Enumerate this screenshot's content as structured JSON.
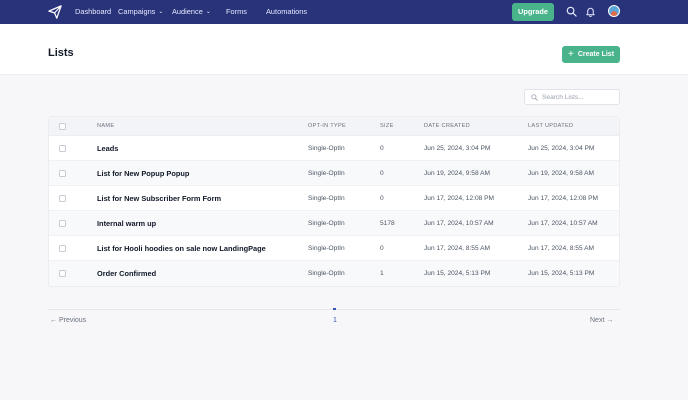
{
  "nav": {
    "items": [
      {
        "label": "Dashboard",
        "dropdown": false
      },
      {
        "label": "Campaigns",
        "dropdown": true
      },
      {
        "label": "Audience",
        "dropdown": true
      },
      {
        "label": "Forms",
        "dropdown": false
      },
      {
        "label": "Automations",
        "dropdown": false
      }
    ],
    "upgrade_label": "Upgrade",
    "icons": [
      "paper-plane-logo",
      "search-icon",
      "bell-icon",
      "avatar"
    ]
  },
  "header": {
    "title": "Lists",
    "create_label": "Create List"
  },
  "search": {
    "placeholder": "Search Lists..."
  },
  "table": {
    "columns": [
      "NAME",
      "OPT-IN TYPE",
      "SIZE",
      "DATE CREATED",
      "LAST UPDATED"
    ],
    "rows": [
      {
        "name": "Leads",
        "optin": "Single-OptIn",
        "size": "0",
        "created": "Jun 25, 2024, 3:04 PM",
        "updated": "Jun 25, 2024, 3:04 PM"
      },
      {
        "name": "List for New Popup Popup",
        "optin": "Single-OptIn",
        "size": "0",
        "created": "Jun 19, 2024, 9:58 AM",
        "updated": "Jun 19, 2024, 9:58 AM"
      },
      {
        "name": "List for New Subscriber Form Form",
        "optin": "Single-OptIn",
        "size": "0",
        "created": "Jun 17, 2024, 12:08 PM",
        "updated": "Jun 17, 2024, 12:08 PM"
      },
      {
        "name": "Internal warm up",
        "optin": "Single-OptIn",
        "size": "5178",
        "created": "Jun 17, 2024, 10:57 AM",
        "updated": "Jun 17, 2024, 10:57 AM"
      },
      {
        "name": "List for Hooli hoodies on sale now LandingPage",
        "optin": "Single-OptIn",
        "size": "0",
        "created": "Jun 17, 2024, 8:55 AM",
        "updated": "Jun 17, 2024, 8:55 AM"
      },
      {
        "name": "Order Confirmed",
        "optin": "Single-OptIn",
        "size": "1",
        "created": "Jun 15, 2024, 5:13 PM",
        "updated": "Jun 15, 2024, 5:13 PM"
      }
    ]
  },
  "pagination": {
    "prev_label": "← Previous",
    "next_label": "Next →",
    "current_page": "1"
  },
  "colors": {
    "nav_bg": "#28337a",
    "accent_green": "#49b38b",
    "pagination_active": "#3b4fb8"
  }
}
